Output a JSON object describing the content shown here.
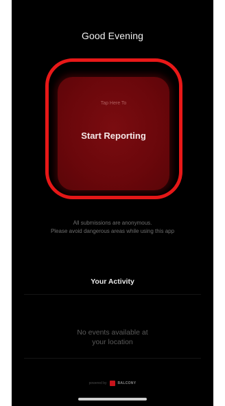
{
  "header": {
    "greeting": "Good Evening"
  },
  "report_tile": {
    "hint": "Tap Here To",
    "label": "Start Reporting"
  },
  "notice": {
    "line1": "All submissions are anonymous.",
    "line2": "Please avoid dangerous areas while using this app"
  },
  "activity": {
    "title": "Your Activity",
    "empty_line1": "No events available at",
    "empty_line2": "your location"
  },
  "footer": {
    "powered_by": "powered by",
    "brand": "BALCONY",
    "brand_icon": "brand-logo-icon"
  },
  "colors": {
    "highlight_ring": "#e81818",
    "tile": "#6a070b",
    "background": "#000000"
  }
}
